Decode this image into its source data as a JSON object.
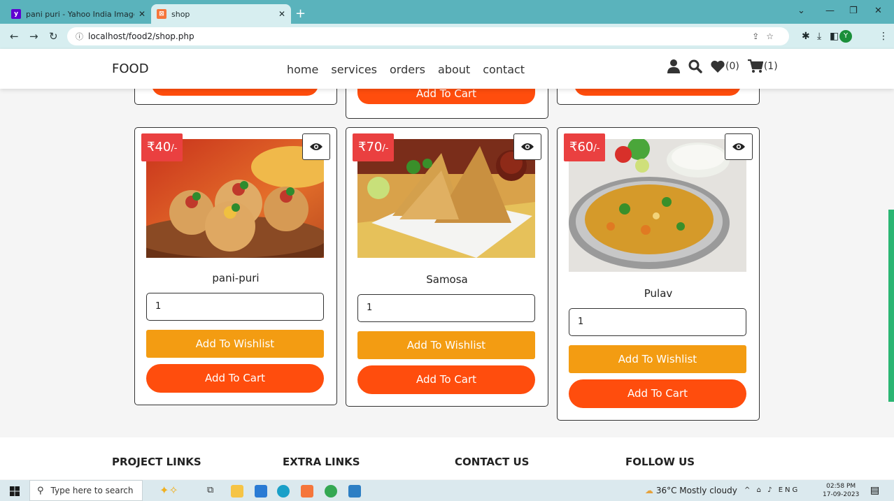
{
  "browser": {
    "tabs": [
      {
        "title": "pani puri - Yahoo India Image Se",
        "favicon": "yahoo-icon"
      },
      {
        "title": "shop",
        "favicon": "xampp-icon"
      }
    ],
    "url": "localhost/food2/shop.php",
    "profile_initial": "Y"
  },
  "site": {
    "logo": "FOOD",
    "nav": [
      "home",
      "services",
      "orders",
      "about",
      "contact"
    ],
    "wishlist_count": "(0)",
    "cart_count": "(1)"
  },
  "partial_row": {
    "middle_button_label": "Add To Cart"
  },
  "products": [
    {
      "name": "pani-puri",
      "price": "₹40",
      "price_suffix": "/-",
      "qty": "1",
      "wishlist_label": "Add To Wishlist",
      "cart_label": "Add To Cart"
    },
    {
      "name": "Samosa",
      "price": "₹70",
      "price_suffix": "/-",
      "qty": "1",
      "wishlist_label": "Add To Wishlist",
      "cart_label": "Add To Cart"
    },
    {
      "name": "Pulav",
      "price": "₹60",
      "price_suffix": "/-",
      "qty": "1",
      "wishlist_label": "Add To Wishlist",
      "cart_label": "Add To Cart"
    }
  ],
  "footer": {
    "headings": [
      "PROJECT LINKS",
      "EXTRA LINKS",
      "CONTACT US",
      "FOLLOW US"
    ]
  },
  "taskbar": {
    "search_placeholder": "Type here to search",
    "weather": "36°C  Mostly cloudy",
    "lang": "ENG",
    "time": "02:58 PM",
    "date": "17-09-2023"
  },
  "colors": {
    "price_badge": "#ea4040",
    "wishlist_button": "#f39c12",
    "cart_button": "#ff4d0d",
    "browser_tabbar": "#5ab3bc"
  }
}
